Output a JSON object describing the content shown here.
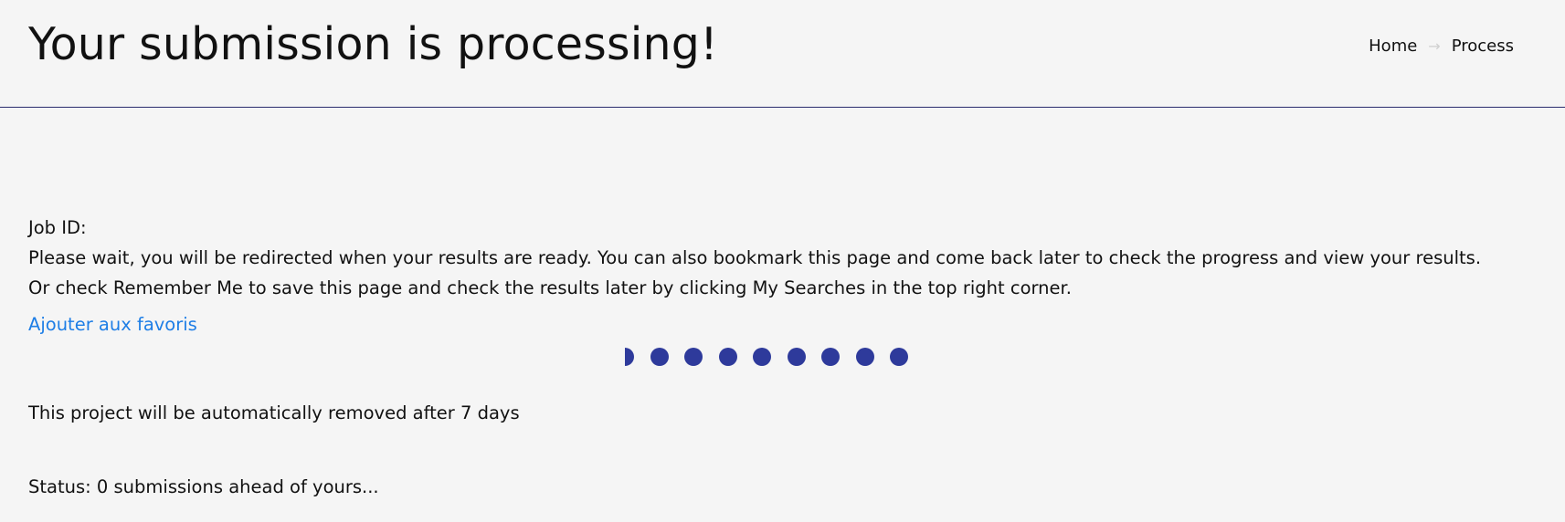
{
  "header": {
    "title": "Your submission is processing!",
    "breadcrumb": {
      "home": "Home",
      "separator": "→",
      "current": "Process"
    }
  },
  "main": {
    "job_id_label": "Job ID:",
    "wait_message": "Please wait, you will be redirected when your results are ready. You can also bookmark this page and come back later to check the progress and view your results.",
    "remember_message": "Or check Remember Me to save this page and check the results later by clicking My Searches in the top right corner.",
    "bookmark_link": "Ajouter aux favoris",
    "expiry_note": "This project will be automatically removed after 7 days",
    "status": "Status: 0 submissions ahead of yours..."
  },
  "loader": {
    "icon": "loading-dots",
    "dot_count": 9,
    "color": "#2e3a9b"
  },
  "colors": {
    "background": "#f5f5f5",
    "link": "#1e7ee6",
    "divider": "#2a2d6e"
  }
}
